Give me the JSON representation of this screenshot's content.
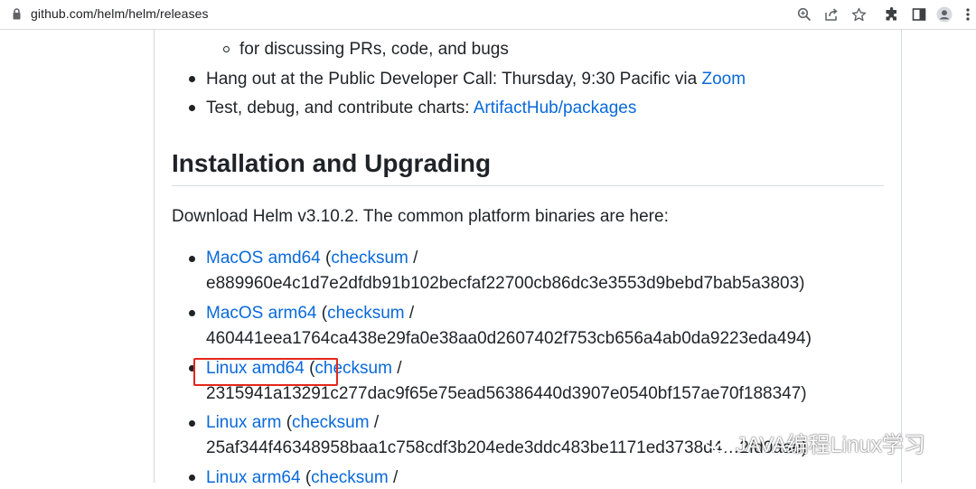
{
  "browser": {
    "url": "github.com/helm/helm/releases",
    "icons": [
      "lock-icon",
      "zoom-icon",
      "share-icon",
      "bookmark-star-icon",
      "extensions-icon",
      "side-panel-icon",
      "profile-icon",
      "menu-icon"
    ]
  },
  "community": {
    "sub_item": "for discussing PRs, code, and bugs",
    "call_prefix": "Hang out at the Public Developer Call: Thursday, 9:30 Pacific via",
    "call_link": "Zoom",
    "charts_prefix": "Test, debug, and contribute charts:",
    "charts_link": "ArtifactHub/packages"
  },
  "install": {
    "heading": "Installation and Upgrading",
    "intro": "Download Helm v3.10.2. The common platform binaries are here:",
    "binaries": [
      {
        "platform": "MacOS amd64",
        "checksum_label": "checksum",
        "hash": "e889960e4c1d7e2dfdb91b102becfaf22700cb86dc3e3553d9bebd7bab5a3803)"
      },
      {
        "platform": "MacOS arm64",
        "checksum_label": "checksum",
        "hash": "460441eea1764ca438e29fa0e38aa0d2607402f753cb656a4ab0da9223eda494)"
      },
      {
        "platform": "Linux amd64",
        "checksum_label": "checksum",
        "hash": "2315941a13291c277dac9f65e75ead56386440d3907e0540bf157ae70f188347)"
      },
      {
        "platform": "Linux arm",
        "checksum_label": "checksum",
        "hash": "25af344f46348958baa1c758cdf3b204ede3ddc483be1171ed3738d4…2fd0aae)"
      },
      {
        "platform": "Linux arm64",
        "checksum_label": "checksum",
        "hash": ""
      }
    ]
  },
  "watermark": {
    "text": "JAVA编程Linux学习"
  },
  "colors": {
    "link": "#0969da",
    "text": "#1f2328",
    "highlight": "#e3261c"
  }
}
